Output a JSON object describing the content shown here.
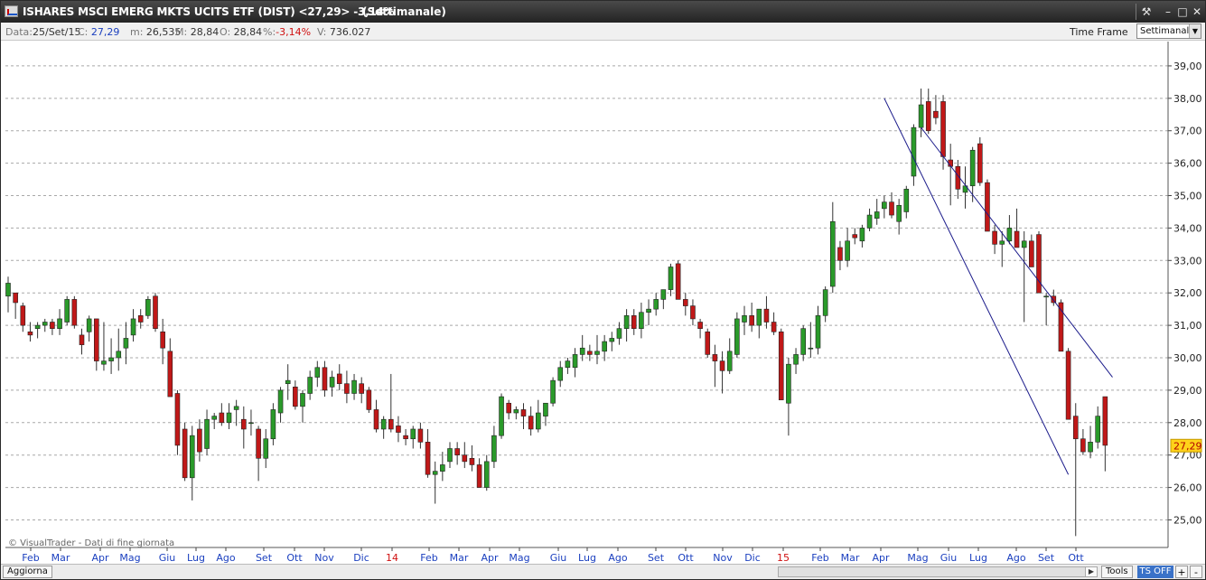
{
  "window": {
    "title": "ISHARES MSCI EMERG MKTS UCITS ETF (DIST) <27,29> -3,14%",
    "period": "(Settimanale)",
    "controls": [
      "tools-icon",
      "minimize-icon",
      "maximize-icon",
      "close-icon"
    ]
  },
  "infobar": {
    "data_label": "Data:",
    "data_value": "25/Set/15",
    "c_label": "C:",
    "c_value": "27,29",
    "m_label": "m:",
    "m_value": "26,535",
    "M_label": "M:",
    "M_value": "28,84",
    "o_label": "O:",
    "o_value": "28,84",
    "pct_label": "%:",
    "pct_value": "-3,14%",
    "v_label": "V:",
    "v_value": "736.027",
    "timeframe_label": "Time Frame",
    "timeframe_value": "Settimanale"
  },
  "chart_data": {
    "type": "candlestick",
    "y_ticks": [
      "25,00",
      "26,00",
      "27,00",
      "28,00",
      "29,00",
      "30,00",
      "31,00",
      "32,00",
      "33,00",
      "34,00",
      "35,00",
      "36,00",
      "37,00",
      "38,00",
      "39,00"
    ],
    "ylim": [
      24.15,
      39.75
    ],
    "grid": "dashed horizontal",
    "last_price_label": "27,29",
    "x_labels": [
      "Feb",
      "Mar",
      "Apr",
      "Mag",
      "Giu",
      "Lug",
      "Ago",
      "Set",
      "Ott",
      "Nov",
      "Dic",
      "14",
      "Feb",
      "Mar",
      "Apr",
      "Mag",
      "Giu",
      "Lug",
      "Ago",
      "Set",
      "Ott",
      "Nov",
      "Dic",
      "15",
      "Feb",
      "Mar",
      "Apr",
      "Mag",
      "Giu",
      "Lug",
      "Ago",
      "Set",
      "Ott"
    ],
    "x_label_colors": [
      "#1a3fbf",
      "#1a3fbf",
      "#1a3fbf",
      "#1a3fbf",
      "#1a3fbf",
      "#1a3fbf",
      "#1a3fbf",
      "#1a3fbf",
      "#1a3fbf",
      "#1a3fbf",
      "#1a3fbf",
      "#d01010",
      "#1a3fbf",
      "#1a3fbf",
      "#1a3fbf",
      "#1a3fbf",
      "#1a3fbf",
      "#1a3fbf",
      "#1a3fbf",
      "#1a3fbf",
      "#1a3fbf",
      "#1a3fbf",
      "#1a3fbf",
      "#d01010",
      "#1a3fbf",
      "#1a3fbf",
      "#1a3fbf",
      "#1a3fbf",
      "#1a3fbf",
      "#1a3fbf",
      "#1a3fbf",
      "#1a3fbf",
      "#1a3fbf"
    ],
    "up_color": "#2a9a2a",
    "down_color": "#c01818",
    "channel_color": "#1a1a8a",
    "channel_lines": [
      {
        "x1_week": 124,
        "y1": 37.1,
        "x2_week": 150,
        "y2": 29.4
      },
      {
        "x1_week": 119,
        "y1": 38.0,
        "x2_week": 144,
        "y2": 26.4
      }
    ],
    "candles": [
      [
        31.9,
        32.5,
        31.4,
        32.3
      ],
      [
        32.0,
        31.9,
        31.2,
        31.7
      ],
      [
        31.6,
        31.7,
        30.8,
        31.0
      ],
      [
        30.8,
        31.1,
        30.5,
        30.7
      ],
      [
        30.9,
        31.1,
        30.6,
        31.0
      ],
      [
        31.0,
        31.2,
        30.8,
        31.1
      ],
      [
        31.1,
        31.2,
        30.7,
        30.9
      ],
      [
        30.9,
        31.5,
        30.7,
        31.2
      ],
      [
        31.1,
        31.9,
        31.0,
        31.8
      ],
      [
        31.8,
        31.9,
        30.9,
        31.0
      ],
      [
        30.7,
        30.9,
        30.1,
        30.4
      ],
      [
        30.8,
        31.3,
        30.5,
        31.2
      ],
      [
        31.2,
        31.2,
        29.6,
        29.9
      ],
      [
        29.8,
        31.1,
        29.6,
        29.9
      ],
      [
        29.9,
        30.6,
        29.5,
        30.0
      ],
      [
        30.0,
        30.9,
        29.6,
        30.2
      ],
      [
        30.3,
        31.1,
        29.8,
        30.6
      ],
      [
        30.7,
        31.5,
        30.5,
        31.2
      ],
      [
        31.3,
        31.5,
        30.9,
        31.1
      ],
      [
        31.3,
        31.9,
        31.2,
        31.8
      ],
      [
        31.9,
        32.0,
        30.8,
        30.9
      ],
      [
        30.8,
        31.2,
        29.8,
        30.3
      ],
      [
        30.2,
        30.6,
        28.8,
        28.8
      ],
      [
        28.9,
        29.0,
        27.0,
        27.3
      ],
      [
        27.8,
        28.0,
        26.2,
        26.3
      ],
      [
        26.3,
        27.9,
        25.6,
        27.6
      ],
      [
        27.8,
        28.1,
        26.8,
        27.1
      ],
      [
        27.2,
        28.4,
        27.0,
        28.1
      ],
      [
        28.1,
        28.3,
        27.8,
        28.2
      ],
      [
        28.3,
        28.6,
        27.9,
        28.0
      ],
      [
        28.0,
        28.6,
        27.8,
        28.3
      ],
      [
        28.4,
        28.7,
        27.9,
        28.5
      ],
      [
        28.1,
        28.5,
        27.2,
        27.8
      ],
      [
        28.0,
        28.4,
        27.6,
        28.0
      ],
      [
        27.8,
        27.9,
        26.2,
        26.9
      ],
      [
        26.9,
        27.8,
        26.6,
        27.5
      ],
      [
        27.5,
        28.6,
        27.3,
        28.4
      ],
      [
        28.3,
        29.1,
        28.0,
        29.0
      ],
      [
        29.2,
        29.8,
        28.7,
        29.3
      ],
      [
        29.1,
        29.3,
        28.4,
        28.5
      ],
      [
        28.5,
        29.0,
        28.0,
        28.9
      ],
      [
        28.9,
        29.6,
        28.7,
        29.4
      ],
      [
        29.4,
        29.9,
        29.1,
        29.7
      ],
      [
        29.7,
        29.9,
        28.8,
        29.0
      ],
      [
        29.1,
        29.6,
        28.8,
        29.4
      ],
      [
        29.5,
        29.8,
        29.0,
        29.2
      ],
      [
        29.2,
        29.6,
        28.6,
        28.9
      ],
      [
        28.9,
        29.5,
        28.7,
        29.3
      ],
      [
        29.2,
        29.4,
        28.6,
        28.9
      ],
      [
        29.0,
        29.1,
        28.3,
        28.4
      ],
      [
        28.4,
        28.7,
        27.7,
        27.8
      ],
      [
        27.8,
        28.2,
        27.5,
        28.1
      ],
      [
        28.1,
        29.5,
        27.7,
        27.8
      ],
      [
        27.9,
        28.2,
        27.4,
        27.7
      ],
      [
        27.6,
        27.8,
        27.3,
        27.5
      ],
      [
        27.5,
        27.9,
        27.2,
        27.8
      ],
      [
        27.8,
        28.0,
        27.2,
        27.4
      ],
      [
        27.4,
        27.8,
        26.3,
        26.4
      ],
      [
        26.4,
        26.8,
        25.5,
        26.5
      ],
      [
        26.5,
        27.1,
        26.2,
        26.7
      ],
      [
        26.8,
        27.4,
        26.6,
        27.2
      ],
      [
        27.2,
        27.4,
        26.7,
        27.0
      ],
      [
        27.0,
        27.4,
        26.6,
        26.8
      ],
      [
        26.9,
        27.3,
        26.5,
        26.7
      ],
      [
        26.7,
        26.9,
        26.0,
        26.0
      ],
      [
        26.0,
        27.0,
        25.9,
        26.8
      ],
      [
        26.8,
        27.9,
        26.6,
        27.6
      ],
      [
        27.6,
        28.9,
        27.5,
        28.8
      ],
      [
        28.6,
        28.7,
        28.1,
        28.3
      ],
      [
        28.3,
        28.5,
        28.1,
        28.4
      ],
      [
        28.4,
        28.6,
        27.8,
        28.2
      ],
      [
        28.2,
        28.5,
        27.6,
        27.8
      ],
      [
        27.8,
        28.7,
        27.7,
        28.3
      ],
      [
        28.2,
        28.4,
        27.9,
        28.6
      ],
      [
        28.6,
        29.4,
        28.5,
        29.3
      ],
      [
        29.3,
        29.9,
        29.1,
        29.7
      ],
      [
        29.7,
        30.0,
        29.5,
        29.9
      ],
      [
        29.7,
        30.3,
        29.4,
        30.1
      ],
      [
        30.1,
        30.7,
        29.9,
        30.3
      ],
      [
        30.2,
        30.4,
        29.9,
        30.1
      ],
      [
        30.1,
        30.7,
        29.8,
        30.2
      ],
      [
        30.2,
        30.7,
        29.9,
        30.5
      ],
      [
        30.5,
        30.8,
        30.2,
        30.6
      ],
      [
        30.6,
        31.1,
        30.4,
        30.9
      ],
      [
        30.9,
        31.5,
        30.5,
        31.3
      ],
      [
        31.3,
        31.5,
        30.7,
        30.9
      ],
      [
        30.9,
        31.7,
        30.6,
        31.4
      ],
      [
        31.4,
        31.8,
        31.0,
        31.5
      ],
      [
        31.5,
        32.0,
        31.3,
        31.8
      ],
      [
        31.8,
        32.1,
        31.5,
        32.1
      ],
      [
        32.1,
        32.9,
        31.9,
        32.8
      ],
      [
        32.9,
        33.0,
        31.8,
        31.8
      ],
      [
        31.8,
        32.0,
        31.3,
        31.6
      ],
      [
        31.6,
        31.8,
        31.0,
        31.2
      ],
      [
        31.1,
        31.2,
        30.6,
        30.9
      ],
      [
        30.8,
        30.9,
        30.0,
        30.1
      ],
      [
        30.1,
        30.4,
        29.1,
        29.9
      ],
      [
        29.9,
        30.2,
        28.9,
        29.6
      ],
      [
        29.6,
        30.6,
        29.5,
        30.2
      ],
      [
        30.1,
        31.4,
        30.0,
        31.2
      ],
      [
        31.1,
        31.6,
        30.7,
        31.3
      ],
      [
        31.3,
        31.7,
        30.8,
        31.0
      ],
      [
        31.0,
        31.4,
        30.6,
        31.5
      ],
      [
        31.5,
        31.9,
        30.9,
        31.1
      ],
      [
        31.1,
        31.4,
        30.7,
        30.8
      ],
      [
        30.8,
        30.9,
        28.7,
        28.7
      ],
      [
        28.6,
        30.0,
        27.6,
        29.8
      ],
      [
        29.8,
        30.3,
        29.5,
        30.1
      ],
      [
        30.1,
        31.0,
        29.9,
        30.9
      ],
      [
        30.3,
        31.1,
        30.0,
        30.3
      ],
      [
        30.3,
        31.6,
        30.1,
        31.3
      ],
      [
        31.3,
        32.2,
        31.1,
        32.1
      ],
      [
        32.2,
        34.8,
        32.0,
        34.2
      ],
      [
        33.4,
        33.6,
        32.7,
        33.0
      ],
      [
        33.0,
        34.0,
        32.8,
        33.6
      ],
      [
        33.8,
        34.0,
        33.5,
        33.7
      ],
      [
        33.6,
        34.1,
        33.4,
        34.0
      ],
      [
        34.0,
        34.6,
        33.9,
        34.4
      ],
      [
        34.3,
        34.9,
        34.1,
        34.5
      ],
      [
        34.6,
        35.0,
        34.3,
        34.8
      ],
      [
        34.8,
        35.1,
        34.3,
        34.4
      ],
      [
        34.2,
        34.9,
        33.8,
        34.7
      ],
      [
        34.5,
        35.3,
        34.3,
        35.2
      ],
      [
        35.6,
        37.2,
        35.3,
        37.1
      ],
      [
        37.1,
        38.3,
        36.8,
        37.8
      ],
      [
        37.9,
        38.3,
        36.9,
        37.0
      ],
      [
        37.6,
        38.1,
        37.2,
        37.4
      ],
      [
        37.9,
        38.1,
        35.8,
        36.2
      ],
      [
        36.1,
        36.6,
        34.7,
        35.9
      ],
      [
        35.9,
        36.1,
        34.9,
        35.2
      ],
      [
        35.1,
        35.9,
        34.6,
        35.3
      ],
      [
        35.3,
        36.5,
        34.8,
        36.4
      ],
      [
        36.6,
        36.8,
        35.3,
        35.4
      ],
      [
        35.4,
        35.5,
        33.9,
        33.9
      ],
      [
        33.9,
        34.1,
        33.2,
        33.5
      ],
      [
        33.5,
        33.9,
        32.8,
        33.6
      ],
      [
        33.6,
        34.4,
        33.5,
        34.0
      ],
      [
        33.9,
        34.6,
        33.4,
        33.4
      ],
      [
        33.4,
        33.9,
        31.1,
        33.6
      ],
      [
        33.6,
        33.8,
        32.8,
        32.8
      ],
      [
        33.8,
        33.9,
        32.0,
        32.0
      ],
      [
        31.9,
        32.0,
        31.0,
        31.9
      ],
      [
        31.9,
        32.1,
        31.6,
        31.7
      ],
      [
        31.7,
        31.8,
        30.2,
        30.2
      ],
      [
        30.2,
        30.3,
        28.1,
        28.1
      ],
      [
        28.2,
        28.6,
        24.5,
        27.5
      ],
      [
        27.5,
        27.8,
        27.0,
        27.1
      ],
      [
        27.1,
        27.9,
        26.9,
        27.4
      ],
      [
        27.4,
        28.5,
        27.2,
        28.2
      ],
      [
        28.8,
        28.8,
        26.5,
        27.3
      ]
    ]
  },
  "footer": {
    "watermark": "© VisualTrader - Dati di fine giornata",
    "update_button": "Aggiorna",
    "tools_button": "Tools",
    "ts_off_button": "TS OFF",
    "plus_button": "+",
    "minus_button": "-"
  }
}
